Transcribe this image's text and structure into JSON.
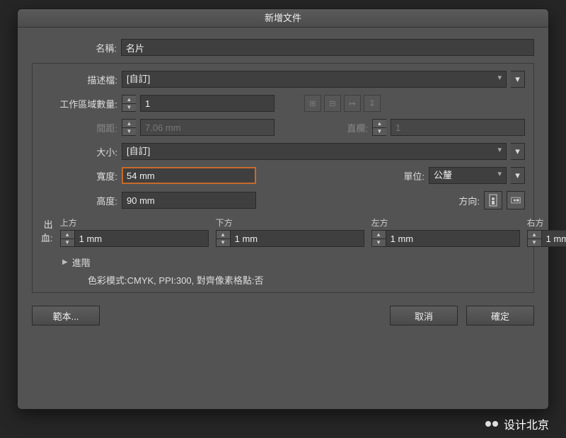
{
  "title": "新增文件",
  "name_label": "名稱:",
  "name_value": "名片",
  "profile_label": "描述檔:",
  "profile_value": "[自訂]",
  "artboards_label": "工作區域數量:",
  "artboards_value": "1",
  "spacing_label": "間距:",
  "spacing_value": "7.06 mm",
  "columns_label": "直欄:",
  "columns_value": "1",
  "size_label": "大小:",
  "size_value": "[自訂]",
  "width_label": "寬度:",
  "width_value": "54 mm",
  "units_label": "單位:",
  "units_value": "公釐",
  "height_label": "高度:",
  "height_value": "90 mm",
  "orient_label": "方向:",
  "bleed_label": "出血:",
  "bleed": {
    "top_label": "上方",
    "top": "1 mm",
    "bottom_label": "下方",
    "bottom": "1 mm",
    "left_label": "左方",
    "left": "1 mm",
    "right_label": "右方",
    "right": "1 mm"
  },
  "advanced_label": "進階",
  "summary": "色彩模式:CMYK, PPI:300, 對齊像素格點:否",
  "templates_btn": "範本...",
  "cancel_btn": "取消",
  "ok_btn": "確定",
  "watermark": "设计北京"
}
